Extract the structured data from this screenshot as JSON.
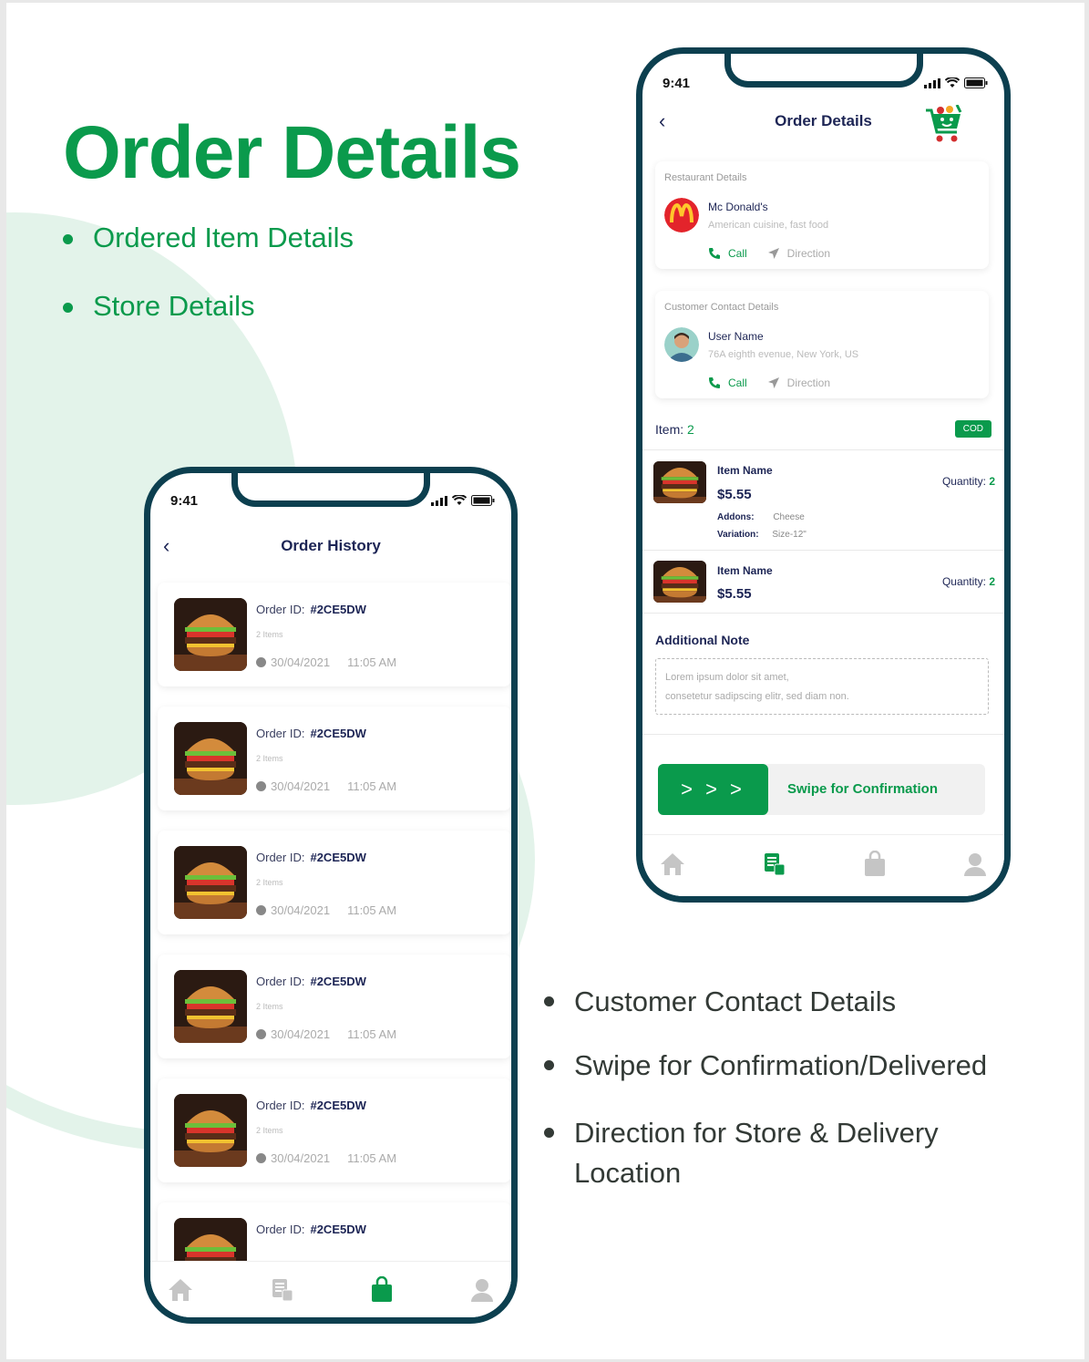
{
  "hero": {
    "title": "Order Details",
    "features_top": [
      "Ordered Item Details",
      "Store Details"
    ],
    "features_bottom": [
      "Customer Contact Details",
      "Swipe for Confirmation/Delivered",
      "Direction for Store & Delivery Location"
    ]
  },
  "colors": {
    "brand_green": "#0a9a4c",
    "phone_frame": "#0c3f4f",
    "heading_navy": "#1d2555"
  },
  "history_phone": {
    "time": "9:41",
    "title": "Order History",
    "orders": [
      {
        "label": "Order ID:",
        "id": "#2CE5DW",
        "items": "2 Items",
        "date": "30/04/2021",
        "time": "11:05 AM"
      },
      {
        "label": "Order ID:",
        "id": "#2CE5DW",
        "items": "2 Items",
        "date": "30/04/2021",
        "time": "11:05 AM"
      },
      {
        "label": "Order ID:",
        "id": "#2CE5DW",
        "items": "2 Items",
        "date": "30/04/2021",
        "time": "11:05 AM"
      },
      {
        "label": "Order ID:",
        "id": "#2CE5DW",
        "items": "2 Items",
        "date": "30/04/2021",
        "time": "11:05 AM"
      },
      {
        "label": "Order ID:",
        "id": "#2CE5DW",
        "items": "2 Items",
        "date": "30/04/2021",
        "time": "11:05 AM"
      },
      {
        "label": "Order ID:",
        "id": "#2CE5DW"
      }
    ],
    "tabs": [
      "home-icon",
      "orders-icon",
      "bag-icon",
      "profile-icon"
    ],
    "active_tab": "bag-icon"
  },
  "details_phone": {
    "time": "9:41",
    "title": "Order Details",
    "restaurant": {
      "section": "Restaurant Details",
      "name": "Mc Donald's",
      "cuisine": "American cuisine, fast food",
      "call": "Call",
      "direction": "Direction"
    },
    "customer": {
      "section": "Customer Contact Details",
      "name": "User Name",
      "address": "76A eighth evenue, New York, US",
      "call": "Call",
      "direction": "Direction"
    },
    "item_label": "Item:",
    "item_count": "2",
    "payment_badge": "COD",
    "items": [
      {
        "name": "Item Name",
        "price": "$5.55",
        "qty_label": "Quantity:",
        "qty": "2",
        "addons_label": "Addons:",
        "addons": "Cheese",
        "variation_label": "Variation:",
        "variation": "Size-12\""
      },
      {
        "name": "Item Name",
        "price": "$5.55",
        "qty_label": "Quantity:",
        "qty": "2"
      }
    ],
    "note_title": "Additional Note",
    "note_line1": "Lorem ipsum dolor sit amet,",
    "note_line2": "consetetur sadipscing elitr, sed diam non.",
    "swipe_arrows": "> > >",
    "swipe_label": "Swipe for Confirmation",
    "tabs": [
      "home-icon",
      "orders-icon",
      "bag-icon",
      "profile-icon"
    ],
    "active_tab": "orders-icon"
  }
}
